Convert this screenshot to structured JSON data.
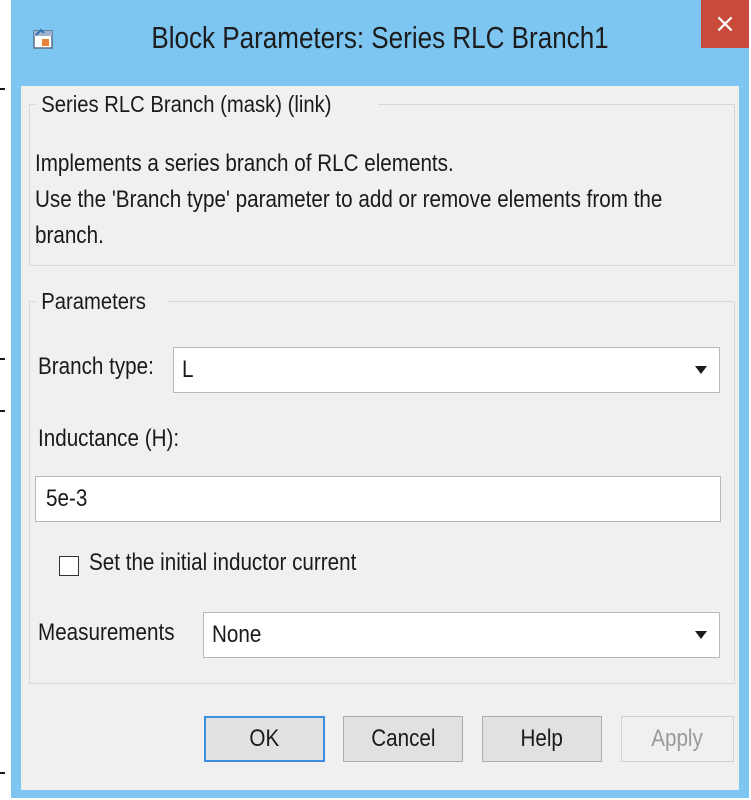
{
  "window": {
    "title": "Block Parameters: Series RLC Branch1",
    "close_glyph": "×",
    "icon": "simulink-block-icon",
    "accent_color": "#7dc6f2",
    "close_color": "#c74a3a"
  },
  "description": {
    "group_label": "Series RLC Branch (mask) (link)",
    "lines": [
      "Implements a series branch of RLC elements.",
      "Use the 'Branch type' parameter to add or remove elements from the",
      "branch."
    ]
  },
  "parameters": {
    "group_label": "Parameters",
    "branch_type": {
      "label": "Branch type:",
      "value": "L"
    },
    "inductance": {
      "label": "Inductance (H):",
      "value": "5e-3"
    },
    "initial_current": {
      "label": "Set the initial inductor current",
      "checked": false
    },
    "measurements": {
      "label": "Measurements",
      "value": "None"
    }
  },
  "buttons": {
    "ok": "OK",
    "cancel": "Cancel",
    "help": "Help",
    "apply": "Apply"
  }
}
